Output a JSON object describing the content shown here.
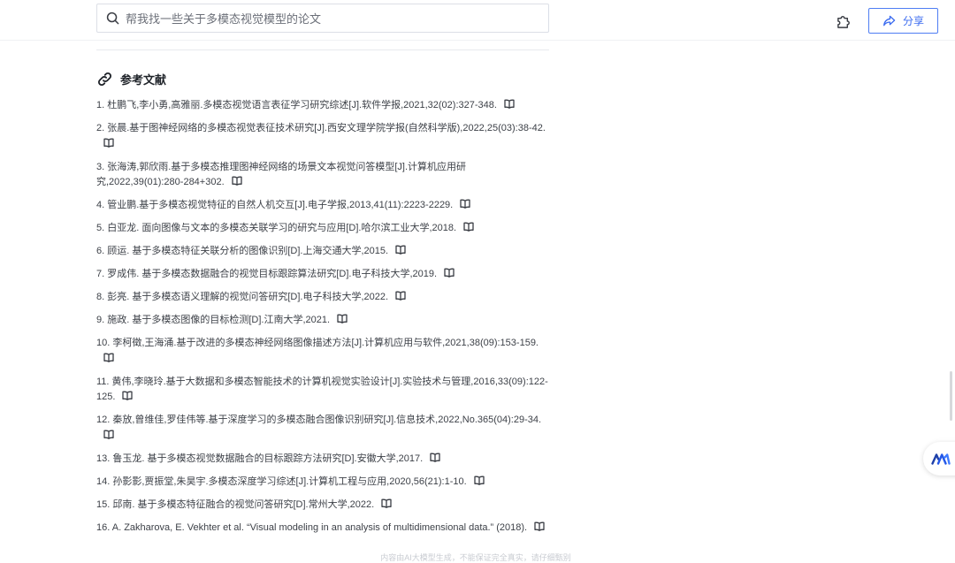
{
  "search": {
    "text": "帮我找一些关于多模态视觉模型的论文"
  },
  "header": {
    "share_label": "分享"
  },
  "section": {
    "title": "参考文献"
  },
  "references": [
    "1. 杜鹏飞,李小勇,高雅丽.多模态视觉语言表征学习研究综述[J].软件学报,2021,32(02):327-348.",
    "2. 张晨.基于图神经网络的多模态视觉表征技术研究[J].西安文理学院学报(自然科学版),2022,25(03):38-42.",
    "3. 张海涛,郭欣雨.基于多模态推理图神经网络的场景文本视觉问答模型[J].计算机应用研究,2022,39(01):280-284+302.",
    "4. 管业鹏.基于多模态视觉特征的自然人机交互[J].电子学报,2013,41(11):2223-2229.",
    "5. 白亚龙. 面向图像与文本的多模态关联学习的研究与应用[D].哈尔滨工业大学,2018.",
    "6. 顾运. 基于多模态特征关联分析的图像识别[D].上海交通大学,2015.",
    "7. 罗成伟. 基于多模态数据融合的视觉目标跟踪算法研究[D].电子科技大学,2019.",
    "8. 彭亮. 基于多模态语义理解的视觉问答研究[D].电子科技大学,2022.",
    "9. 施政. 基于多模态图像的目标检测[D].江南大学,2021.",
    "10. 李柯徵,王海涌.基于改进的多模态神经网络图像描述方法[J].计算机应用与软件,2021,38(09):153-159.",
    "11. 黄伟,李晓玲.基于大数据和多模态智能技术的计算机视觉实验设计[J].实验技术与管理,2016,33(09):122-125.",
    "12. 秦放,曾维佳,罗佳伟等.基于深度学习的多模态融合图像识别研究[J].信息技术,2022,No.365(04):29-34.",
    "13. 鲁玉龙. 基于多模态视觉数据融合的目标跟踪方法研究[D].安徽大学,2017.",
    "14. 孙影影,贾振堂,朱昊宇.多模态深度学习综述[J].计算机工程与应用,2020,56(21):1-10.",
    "15. 邱南. 基于多模态特征融合的视觉问答研究[D].常州大学,2022.",
    "16. A. Zakharova, E. Vekhter et al. “Visual modeling in an analysis of multidimensional data.” (2018)."
  ],
  "footer": {
    "note": "内容由AI大模型生成，不能保证完全真实，请仔细甄别"
  },
  "icons": {
    "search": "search-icon",
    "plugin": "puzzle-icon",
    "share": "share-icon",
    "link": "link-icon",
    "book": "book-icon",
    "assistant": "assistant-logo-icon"
  },
  "colors": {
    "accent": "#3c6cf0",
    "text": "#3d4148"
  }
}
